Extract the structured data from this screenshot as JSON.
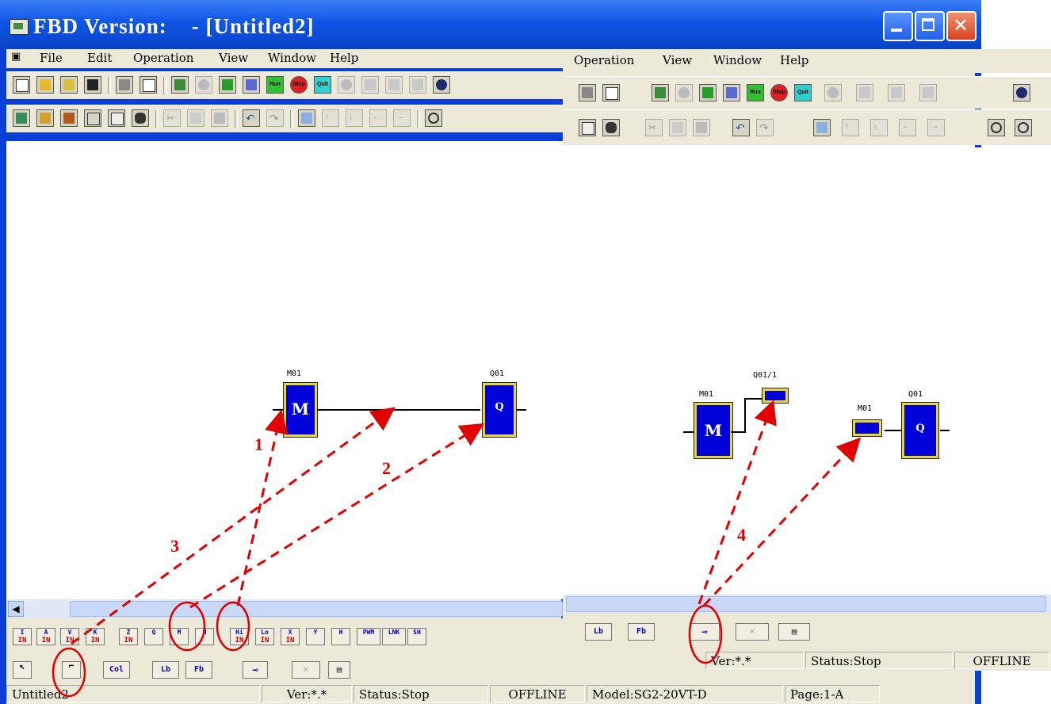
{
  "window": {
    "title": "FBD Version:    - [Untitled2]"
  },
  "menus": [
    "File",
    "Edit",
    "Operation",
    "View",
    "Window",
    "Help"
  ],
  "menus2": [
    "Operation",
    "View",
    "Window",
    "Help"
  ],
  "toolbar_buttons": {
    "run": "Run",
    "stop": "Stop",
    "quit": "Quit"
  },
  "palette": {
    "inputs": [
      {
        "top": "I",
        "bot": "IN"
      },
      {
        "top": "A",
        "bot": "IN"
      },
      {
        "top": "V",
        "bot": "IN"
      },
      {
        "top": "K",
        "bot": "IN"
      },
      {
        "top": "Z",
        "bot": "IN"
      },
      {
        "top": "Q",
        "bot": ""
      },
      {
        "top": "M",
        "bot": ""
      },
      {
        "top": "N",
        "bot": ""
      },
      {
        "top": "Hi",
        "bot": "IN"
      },
      {
        "top": "Lo",
        "bot": "IN"
      },
      {
        "top": "X",
        "bot": "IN"
      },
      {
        "top": "Y",
        "bot": ""
      },
      {
        "top": "H",
        "bot": ""
      },
      {
        "top": "PWM",
        "bot": ""
      },
      {
        "top": "LNK",
        "bot": ""
      },
      {
        "top": "SH",
        "bot": ""
      }
    ],
    "tools": {
      "col": "Col",
      "lb": "Lb",
      "fb": "Fb"
    }
  },
  "status": {
    "file": "Untitled2",
    "ver": "Ver:*.*",
    "state": "Status:Stop",
    "conn": "OFFLINE",
    "model": "Model:SG2-20VT-D",
    "page": "Page:1-A"
  },
  "status2": {
    "ver": "Ver:*.*",
    "state": "Status:Stop",
    "conn": "OFFLINE"
  },
  "diagram_left": {
    "m_label": "M01",
    "m_text": "M",
    "q_label": "Q01",
    "q_text": "Q"
  },
  "diagram_right": {
    "m_label": "M01",
    "m_text": "M",
    "q_label": "Q01",
    "q_text": "Q",
    "tag_out": "Q01/1",
    "tag_in": "M01"
  },
  "annotations": [
    "1",
    "2",
    "3",
    "4"
  ],
  "colors": {
    "annotation": "#e00000",
    "block": "#0000d8",
    "block_border": "#e8d830"
  }
}
